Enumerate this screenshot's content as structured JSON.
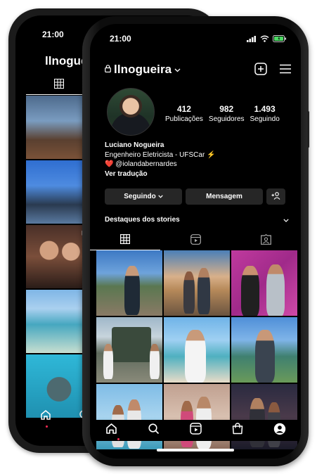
{
  "back_phone": {
    "time": "21:00",
    "username": "llnogueira",
    "icons": [
      "grid-icon",
      "home-icon",
      "search-icon"
    ]
  },
  "front_phone": {
    "status": {
      "time": "21:00",
      "icons": [
        "signal-icon",
        "wifi-icon",
        "battery-icon"
      ]
    },
    "header": {
      "username": "llnogueira",
      "icons": [
        "lock-icon",
        "chevron-down-icon",
        "new-post-icon",
        "menu-icon"
      ]
    },
    "stats": [
      {
        "value": "412",
        "label": "Publicações"
      },
      {
        "value": "982",
        "label": "Seguidores"
      },
      {
        "value": "1.493",
        "label": "Seguindo"
      }
    ],
    "bio": {
      "name": "Luciano Nogueira",
      "line1": "Engenheiro Eletricista - UFSCar ⚡",
      "heart": "❤️",
      "mention": "@iolandabernardes",
      "translate": "Ver tradução"
    },
    "buttons": {
      "following": "Seguindo",
      "message": "Mensagem",
      "add_person_icon": "add-person-icon"
    },
    "highlights": {
      "label": "Destaques dos stories"
    },
    "tabs": [
      "grid-icon",
      "reels-icon",
      "tagged-icon"
    ],
    "bottom_nav": [
      "home-icon",
      "search-icon",
      "reels-icon",
      "shop-icon",
      "profile-icon"
    ]
  }
}
